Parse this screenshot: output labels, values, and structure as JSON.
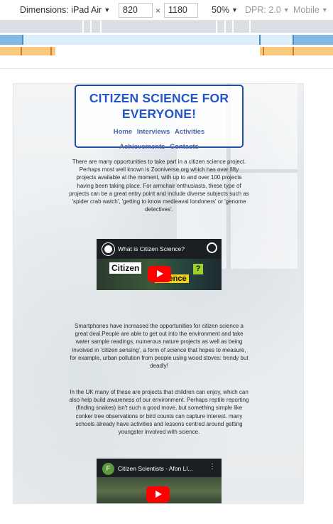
{
  "devtools": {
    "dimensions_label": "Dimensions: iPad Air",
    "width_value": "820",
    "times_sign": "×",
    "height_value": "1180",
    "zoom": "50%",
    "dpr": "DPR: 2.0",
    "mode": "Mobile"
  },
  "site": {
    "title": "CITIZEN SCIENCE FOR EVERYONE!",
    "nav": [
      "Home",
      "Interviews",
      "Activities",
      "Achievements",
      "Contacts"
    ]
  },
  "content": {
    "paragraph1": "There are many opportunities to take part in a citizen science project. Perhaps most well known is Zooniverse.org which has over fifty projects available at the moment, with up to and over 100 projects having been taking place. For armchair enthusiasts, these type of projects can be a great entry point and include diverse subjects such as 'spider crab watch', 'getting to know medieaval londoners' or 'genome detectives'.",
    "video1": {
      "title": "What is Citizen Science?",
      "thumb_word1": "Citizen",
      "thumb_word2": "Science",
      "thumb_mark": "?"
    },
    "paragraph2": "Smartphones have increased the opportunities for citizen science a great deal.People are able to get out into the environment and take water sample readings, numerous nature projects as well as being involved in 'citizen sensing', a form of science that hopes to measure, for example, urban pollution from people using wood stoves: trendy but deadly!",
    "paragraph3": "In the UK many of these are projects that children can enjoy, which can also help build awareness of our environment. Perhaps reptile reporting (finding snakes) isn't such a good move, but something simple like conker tree observations or bird counts can capture interest. many schools already have activities and lessons centred around getting youngster involved with science.",
    "video2": {
      "channel_letter": "F",
      "title": "Citizen Scientists - Afon Ll..."
    }
  },
  "colors": {
    "title": "#2456c8",
    "header_border": "#1f4fa6",
    "play_button": "#ff0000"
  }
}
